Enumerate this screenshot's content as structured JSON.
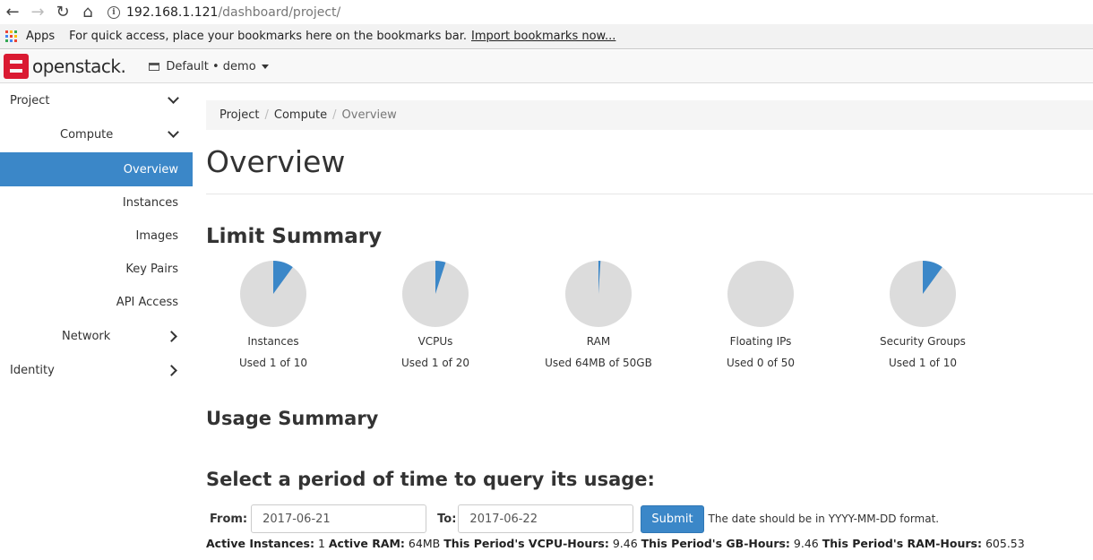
{
  "browser": {
    "url_host": "192.168.1.121",
    "url_path": "/dashboard/project/",
    "apps_label": "Apps",
    "bookmarks_hint": "For quick access, place your bookmarks here on the bookmarks bar.",
    "import_link": "Import bookmarks now..."
  },
  "header": {
    "logo_text": "openstack.",
    "project_picker": "Default • demo"
  },
  "sidebar": {
    "items": [
      {
        "label": "Project",
        "icon": "chevron-down-icon"
      },
      {
        "label": "Compute",
        "icon": "chevron-down-icon"
      },
      {
        "label": "Overview",
        "active": true
      },
      {
        "label": "Instances"
      },
      {
        "label": "Images"
      },
      {
        "label": "Key Pairs"
      },
      {
        "label": "API Access"
      },
      {
        "label": "Network",
        "icon": "chevron-right-icon"
      },
      {
        "label": "Identity",
        "icon": "chevron-right-icon"
      }
    ]
  },
  "breadcrumb": {
    "items": [
      "Project",
      "Compute",
      "Overview"
    ],
    "separator": "/"
  },
  "page_title": "Overview",
  "limit_summary": {
    "heading": "Limit Summary",
    "charts": [
      {
        "label": "Instances",
        "used_text": "Used 1 of 10",
        "fraction": 0.1
      },
      {
        "label": "VCPUs",
        "used_text": "Used 1 of 20",
        "fraction": 0.05
      },
      {
        "label": "RAM",
        "used_text": "Used 64MB of 50GB",
        "fraction": 0.00125
      },
      {
        "label": "Floating IPs",
        "used_text": "Used 0 of 50",
        "fraction": 0
      },
      {
        "label": "Security Groups",
        "used_text": "Used 1 of 10",
        "fraction": 0.1
      }
    ],
    "used_color": "#3b87c8",
    "free_color": "#dcdcdc"
  },
  "usage_summary": {
    "heading": "Usage Summary",
    "period_heading": "Select a period of time to query its usage:",
    "from_label": "From:",
    "from_value": "2017-06-21",
    "to_label": "To:",
    "to_value": "2017-06-22",
    "submit_label": "Submit",
    "hint": "The date should be in YYYY-MM-DD format."
  },
  "stats": {
    "active_instances_label": "Active Instances:",
    "active_instances_value": "1",
    "active_ram_label": "Active RAM:",
    "active_ram_value": "64MB",
    "vcpu_hours_label": "This Period's VCPU-Hours:",
    "vcpu_hours_value": "9.46",
    "gb_hours_label": "This Period's GB-Hours:",
    "gb_hours_value": "9.46",
    "ram_hours_label": "This Period's RAM-Hours:",
    "ram_hours_value": "605.53"
  }
}
